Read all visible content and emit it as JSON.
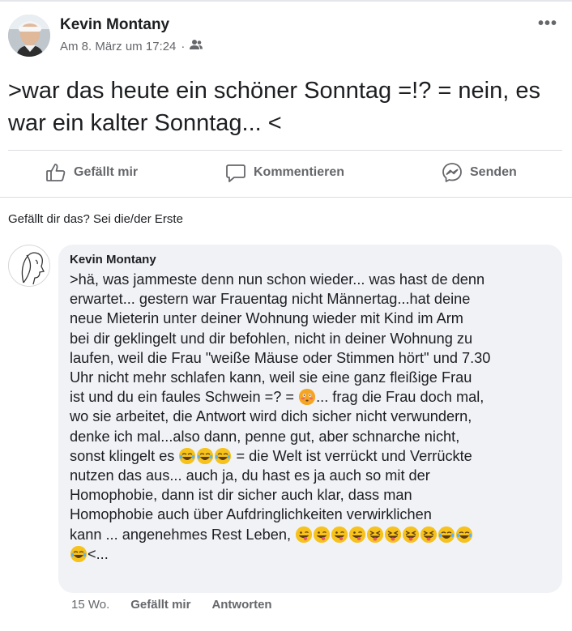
{
  "post": {
    "author": "Kevin Montany",
    "timestamp": "Am 8. März um 17:24",
    "separator": "·",
    "audience_icon": "friends-icon",
    "more_icon": "more-options-icon",
    "more_label": "•••",
    "text": ">war das heute ein schöner Sonntag =!? = nein, es war ein kalter Sonntag... <"
  },
  "actions": {
    "like_label": "Gefällt mir",
    "comment_label": "Kommentieren",
    "send_label": "Senden"
  },
  "reactions": {
    "prompt": "Gefällt dir das? Sei die/der Erste"
  },
  "comment": {
    "author": "Kevin Montany",
    "text_part1": ">hä, was jammeste denn nun schon wieder... was hast de denn\nerwartet... gestern war Frauentag nicht Männertag...hat deine\nneue Mieterin unter deiner Wohnung wieder mit Kind im Arm\nbei dir geklingelt und dir befohlen, nicht in deiner Wohnung zu\nlaufen, weil die Frau \"weiße Mäuse oder Stimmen hört\" und 7.30\nUhr nicht mehr schlafen kann, weil sie eine ganz fleißige Frau\nist und du ein faules Schwein =? = ",
    "text_part2": "... frag die Frau doch mal,\nwo sie arbeitet, die Antwort wird dich sicher nicht verwundern,\ndenke ich mal...also dann, penne gut, aber schnarche nicht,\nsonst klingelt es ",
    "text_part3": " = die Welt ist verrückt und Verrückte\nnutzen das aus... auch ja, du hast es ja auch so mit der\nHomophobie, dann ist dir sicher auch klar, dass man\nHomophobie  auch über Aufdringlichkeiten verwirklichen\nkann  ... angenehmes Rest Leben, ",
    "text_part4": "<...",
    "time": "15 Wo.",
    "like_label": "Gefällt mir",
    "reply_label": "Antworten"
  },
  "colors": {
    "secondary_text": "#65676b",
    "bubble": "#f0f2f5",
    "divider": "#dadde1"
  }
}
